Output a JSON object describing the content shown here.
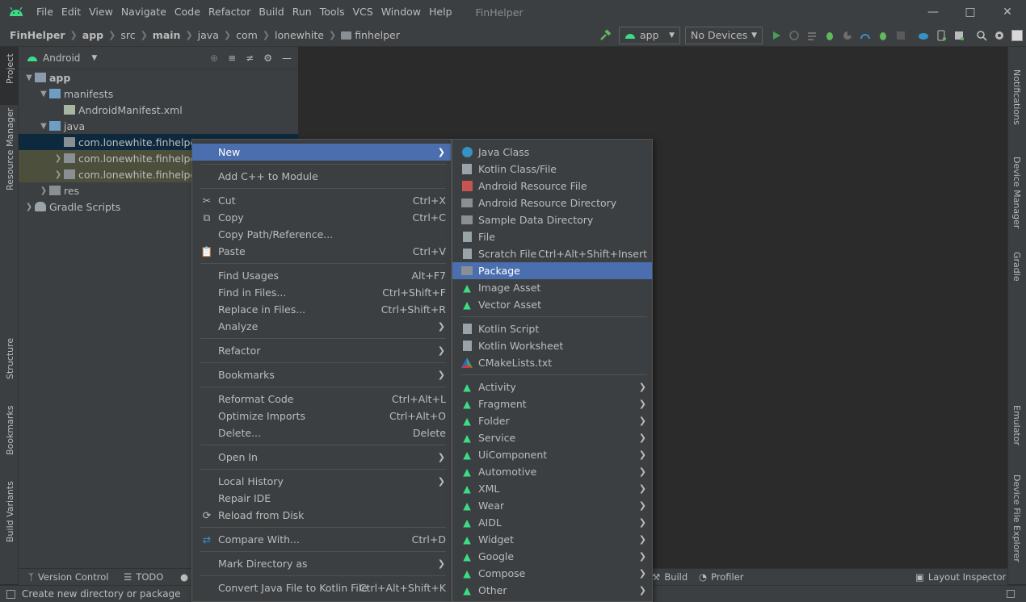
{
  "menubar": {
    "items": [
      "File",
      "Edit",
      "View",
      "Navigate",
      "Code",
      "Refactor",
      "Build",
      "Run",
      "Tools",
      "VCS",
      "Window",
      "Help"
    ],
    "title": "FinHelper"
  },
  "breadcrumb": [
    "FinHelper",
    "app",
    "src",
    "main",
    "java",
    "com",
    "lonewhite",
    "finhelper"
  ],
  "toolbar": {
    "run_config": "app",
    "device": "No Devices"
  },
  "project": {
    "view": "Android",
    "tree": [
      {
        "label": "app",
        "level": 0
      },
      {
        "label": "manifests",
        "level": 1
      },
      {
        "label": "AndroidManifest.xml",
        "level": 2
      },
      {
        "label": "java",
        "level": 1
      },
      {
        "label": "com.lonewhite.finhelper",
        "level": 2
      },
      {
        "label": "com.lonewhite.finhelper",
        "level": 2
      },
      {
        "label": "com.lonewhite.finhelper",
        "level": 2
      },
      {
        "label": "res",
        "level": 1
      },
      {
        "label": "Gradle Scripts",
        "level": 0
      }
    ]
  },
  "left_tabs": [
    "Project",
    "Resource Manager",
    "Structure",
    "Bookmarks",
    "Build Variants"
  ],
  "right_tabs": [
    "Notifications",
    "Device Manager",
    "Gradle",
    "Emulator",
    "Device File Explorer"
  ],
  "bottom_tabs": [
    "Version Control",
    "TODO",
    "Build",
    "Profiler",
    "Layout Inspector"
  ],
  "status": "Create new directory or package",
  "context_menu": [
    {
      "label": "New",
      "sub": true
    },
    {
      "label": "Add C++ to Module"
    },
    {
      "label": "Cut",
      "shortcut": "Ctrl+X"
    },
    {
      "label": "Copy",
      "shortcut": "Ctrl+C"
    },
    {
      "label": "Copy Path/Reference..."
    },
    {
      "label": "Paste",
      "shortcut": "Ctrl+V"
    },
    {
      "label": "Find Usages",
      "shortcut": "Alt+F7"
    },
    {
      "label": "Find in Files...",
      "shortcut": "Ctrl+Shift+F"
    },
    {
      "label": "Replace in Files...",
      "shortcut": "Ctrl+Shift+R"
    },
    {
      "label": "Analyze",
      "sub": true
    },
    {
      "label": "Refactor",
      "sub": true
    },
    {
      "label": "Bookmarks",
      "sub": true
    },
    {
      "label": "Reformat Code",
      "shortcut": "Ctrl+Alt+L"
    },
    {
      "label": "Optimize Imports",
      "shortcut": "Ctrl+Alt+O"
    },
    {
      "label": "Delete...",
      "shortcut": "Delete"
    },
    {
      "label": "Open In",
      "sub": true
    },
    {
      "label": "Local History",
      "sub": true
    },
    {
      "label": "Repair IDE"
    },
    {
      "label": "Reload from Disk"
    },
    {
      "label": "Compare With...",
      "shortcut": "Ctrl+D"
    },
    {
      "label": "Mark Directory as",
      "sub": true
    },
    {
      "label": "Convert Java File to Kotlin File",
      "shortcut": "Ctrl+Alt+Shift+K"
    }
  ],
  "submenu": [
    {
      "label": "Java Class"
    },
    {
      "label": "Kotlin Class/File"
    },
    {
      "label": "Android Resource File"
    },
    {
      "label": "Android Resource Directory"
    },
    {
      "label": "Sample Data Directory"
    },
    {
      "label": "File"
    },
    {
      "label": "Scratch File",
      "shortcut": "Ctrl+Alt+Shift+Insert"
    },
    {
      "label": "Package"
    },
    {
      "label": "Image Asset"
    },
    {
      "label": "Vector Asset"
    },
    {
      "label": "Kotlin Script"
    },
    {
      "label": "Kotlin Worksheet"
    },
    {
      "label": "CMakeLists.txt"
    },
    {
      "label": "Activity",
      "sub": true
    },
    {
      "label": "Fragment",
      "sub": true
    },
    {
      "label": "Folder",
      "sub": true
    },
    {
      "label": "Service",
      "sub": true
    },
    {
      "label": "UiComponent",
      "sub": true
    },
    {
      "label": "Automotive",
      "sub": true
    },
    {
      "label": "XML",
      "sub": true
    },
    {
      "label": "Wear",
      "sub": true
    },
    {
      "label": "AIDL",
      "sub": true
    },
    {
      "label": "Widget",
      "sub": true
    },
    {
      "label": "Google",
      "sub": true
    },
    {
      "label": "Compose",
      "sub": true
    },
    {
      "label": "Other",
      "sub": true
    }
  ],
  "colors": {
    "android_green": "#3ddc84",
    "selection": "#4b6eaf",
    "folder": "#6e9ec4"
  }
}
